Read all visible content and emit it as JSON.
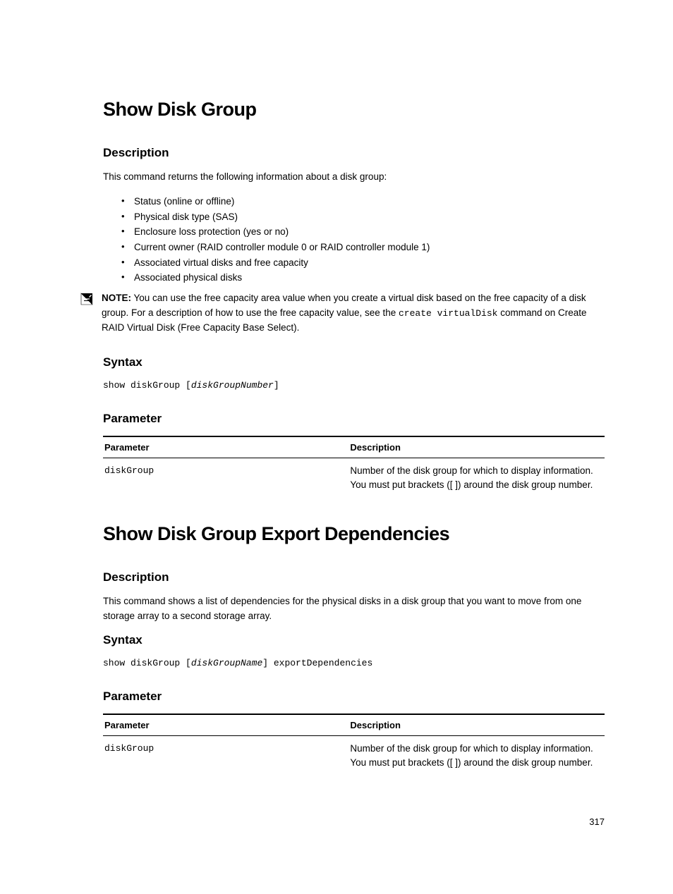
{
  "section1": {
    "title": "Show Disk Group",
    "description_heading": "Description",
    "description_intro": "This command returns the following information about a disk group:",
    "bullets": [
      "Status (online or offline)",
      "Physical disk type (SAS)",
      "Enclosure loss protection (yes or no)",
      "Current owner (RAID controller module 0 or RAID controller module 1)",
      "Associated virtual disks and free capacity",
      "Associated physical disks"
    ],
    "note_label": "NOTE:",
    "note_text_1": " You can use the free capacity area value when you create a virtual disk based on the free capacity of a disk group. For a description of how to use the free capacity value, see the ",
    "note_code": "create virtualDisk",
    "note_text_2": " command on Create RAID Virtual Disk (Free Capacity Base Select).",
    "syntax_heading": "Syntax",
    "syntax_prefix": "show diskGroup [",
    "syntax_param": "diskGroupNumber",
    "syntax_suffix": "]",
    "parameter_heading": "Parameter",
    "table": {
      "header_param": "Parameter",
      "header_desc": "Description",
      "row_param": "diskGroup",
      "row_desc": "Number of the disk group for which to display information. You must put brackets ([ ]) around the disk group number."
    }
  },
  "section2": {
    "title": "Show Disk Group Export Dependencies",
    "description_heading": "Description",
    "description_text": "This command shows a list of dependencies for the physical disks in a disk group that you want to move from one storage array to a second storage array.",
    "syntax_heading": "Syntax",
    "syntax_prefix": "show diskGroup [",
    "syntax_param": "diskGroupName",
    "syntax_suffix": "] exportDependencies",
    "parameter_heading": "Parameter",
    "table": {
      "header_param": "Parameter",
      "header_desc": "Description",
      "row_param": "diskGroup",
      "row_desc": "Number of the disk group for which to display information. You must put brackets ([ ]) around the disk group number."
    }
  },
  "page_number": "317"
}
